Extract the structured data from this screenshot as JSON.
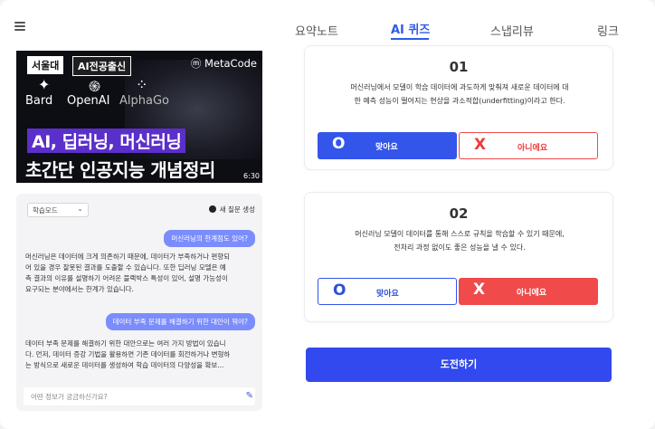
{
  "nav": {
    "menu_icon": "hamburger-menu-icon",
    "tabs": [
      {
        "label": "요약노트"
      },
      {
        "label": "AI 퀴즈"
      },
      {
        "label": "스냅리뷰"
      },
      {
        "label": "링크"
      }
    ],
    "active_tab": "AI 퀴즈",
    "accent_color": "#2f5bea"
  },
  "video": {
    "badge_univ": "서울대",
    "badge_ai": "AI전공출신",
    "channel": "ⓜ MetaCode",
    "brands": [
      "Bard",
      "OpenAI",
      "AlphaGo"
    ],
    "headline1": "AI, 딥러닝, 머신러닝",
    "headline2": "초간단 인공지능 개념정리",
    "duration": "6:30"
  },
  "chat": {
    "mode_label": "학습모드",
    "new_question": "새 질문 생성",
    "messages": [
      {
        "role": "user",
        "text": "머신러닝의 한계점도 있어?"
      },
      {
        "role": "assistant",
        "lines": [
          "머신러닝은 데이터에 크게 의존하기 때문에, 데이터가 부족하거나 편향되",
          "어 있을 경우 잘못된 결과를 도출할 수 있습니다. 또한 딥러닝 모델은 예",
          "측 결과의 이유를 설명하기 어려운 블랙박스 특성이 있어, 설명 가능성이",
          "요구되는 분야에서는 한계가 있습니다."
        ]
      },
      {
        "role": "user",
        "text": "데이터 부족 문제를 해결하기 위한 대안이 뭐야?"
      },
      {
        "role": "assistant",
        "lines": [
          "데이터 부족 문제를 해결하기 위한 대안으로는 여러 가지 방법이 있습니",
          "다. 먼저, 데이터 증강 기법을 활용하면 기존 데이터를 회전하거나 변형하",
          "는 방식으로 새로운 데이터를 생성하여 학습 데이터의 다양성을 확보..."
        ]
      }
    ],
    "input_placeholder": "어떤 정보가 궁금하신가요?",
    "bubble_color": "#7b8dfc"
  },
  "quiz": {
    "questions": [
      {
        "number": "01",
        "lines": [
          "머신러닝에서 모델이 학습 데이터에 과도하게 맞춰져 새로운 데이터에 대",
          "한 예측 성능이 떨어지는 현상을 과소적합(underfitting)이라고 한다."
        ],
        "o_mark": "O",
        "o_label": "맞아요",
        "x_mark": "X",
        "x_label": "아니에요",
        "selected": "O"
      },
      {
        "number": "02",
        "lines": [
          "머신러닝 모델이 데이터를 통해 스스로 규칙을 학습할 수 있기 때문에,",
          "전처리 과정 없이도 좋은 성능을 낼 수 있다."
        ],
        "o_mark": "O",
        "o_label": "맞아요",
        "x_mark": "X",
        "x_label": "아니에요",
        "selected": "X"
      }
    ],
    "challenge_label": "도전하기",
    "blue": "#3355ea",
    "red": "#f04a4a"
  }
}
